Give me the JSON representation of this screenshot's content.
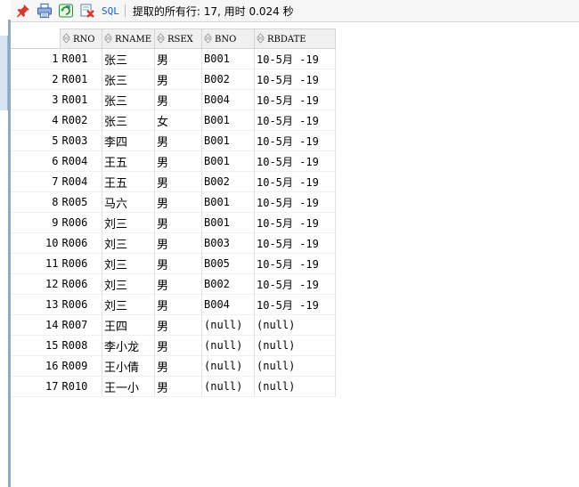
{
  "toolbar": {
    "buttons": [
      {
        "name": "pin-icon",
        "color": "#d33a2c"
      },
      {
        "name": "print-icon",
        "color": "#4a74b8"
      },
      {
        "name": "refresh-icon",
        "color": "#2d8a3e"
      },
      {
        "name": "export-icon",
        "color": "#c0392b"
      }
    ],
    "sql_label": "SQL",
    "status_text": "提取的所有行: 17, 用时 0.024 秒"
  },
  "grid": {
    "columns": [
      "RNO",
      "RNAME",
      "RSEX",
      "BNO",
      "RBDATE"
    ],
    "rows": [
      {
        "num": "1",
        "rno": "R001",
        "rname": "张三",
        "rsex": "男",
        "bno": "B001",
        "rbdate": "10-5月 -19"
      },
      {
        "num": "2",
        "rno": "R001",
        "rname": "张三",
        "rsex": "男",
        "bno": "B002",
        "rbdate": "10-5月 -19"
      },
      {
        "num": "3",
        "rno": "R001",
        "rname": "张三",
        "rsex": "男",
        "bno": "B004",
        "rbdate": "10-5月 -19"
      },
      {
        "num": "4",
        "rno": "R002",
        "rname": "张三",
        "rsex": "女",
        "bno": "B001",
        "rbdate": "10-5月 -19"
      },
      {
        "num": "5",
        "rno": "R003",
        "rname": "李四",
        "rsex": "男",
        "bno": "B001",
        "rbdate": "10-5月 -19"
      },
      {
        "num": "6",
        "rno": "R004",
        "rname": "王五",
        "rsex": "男",
        "bno": "B001",
        "rbdate": "10-5月 -19"
      },
      {
        "num": "7",
        "rno": "R004",
        "rname": "王五",
        "rsex": "男",
        "bno": "B002",
        "rbdate": "10-5月 -19"
      },
      {
        "num": "8",
        "rno": "R005",
        "rname": "马六",
        "rsex": "男",
        "bno": "B001",
        "rbdate": "10-5月 -19"
      },
      {
        "num": "9",
        "rno": "R006",
        "rname": "刘三",
        "rsex": "男",
        "bno": "B001",
        "rbdate": "10-5月 -19"
      },
      {
        "num": "10",
        "rno": "R006",
        "rname": "刘三",
        "rsex": "男",
        "bno": "B003",
        "rbdate": "10-5月 -19"
      },
      {
        "num": "11",
        "rno": "R006",
        "rname": "刘三",
        "rsex": "男",
        "bno": "B005",
        "rbdate": "10-5月 -19"
      },
      {
        "num": "12",
        "rno": "R006",
        "rname": "刘三",
        "rsex": "男",
        "bno": "B002",
        "rbdate": "10-5月 -19"
      },
      {
        "num": "13",
        "rno": "R006",
        "rname": "刘三",
        "rsex": "男",
        "bno": "B004",
        "rbdate": "10-5月 -19"
      },
      {
        "num": "14",
        "rno": "R007",
        "rname": "王四",
        "rsex": "男",
        "bno": "(null)",
        "rbdate": "(null)"
      },
      {
        "num": "15",
        "rno": "R008",
        "rname": "李小龙",
        "rsex": "男",
        "bno": "(null)",
        "rbdate": "(null)"
      },
      {
        "num": "16",
        "rno": "R009",
        "rname": "王小倩",
        "rsex": "男",
        "bno": "(null)",
        "rbdate": "(null)"
      },
      {
        "num": "17",
        "rno": "R010",
        "rname": "王一小",
        "rsex": "男",
        "bno": "(null)",
        "rbdate": "(null)"
      }
    ]
  }
}
